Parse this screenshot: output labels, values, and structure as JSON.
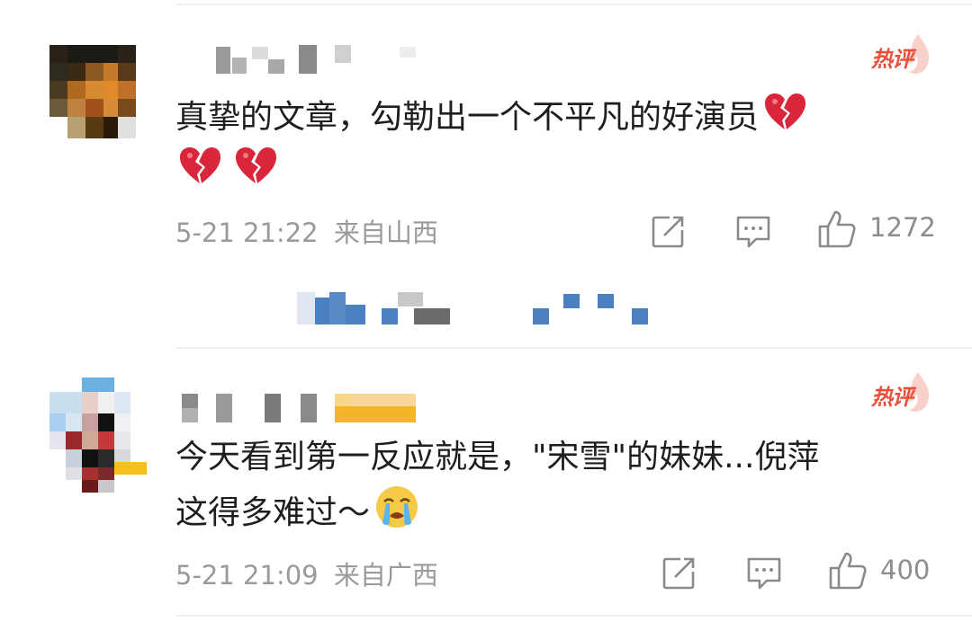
{
  "comments": [
    {
      "hot_badge": "热评",
      "text_line1": "真挚的文章，勾勒出一个不平凡的好演员",
      "emoji_names": [
        "broken-heart-icon",
        "broken-heart-icon",
        "broken-heart-icon"
      ],
      "date": "5-21 21:22",
      "location": "来自山西",
      "like_count": "1272"
    },
    {
      "hot_badge": "热评",
      "text_line1": "今天看到第一反应就是，\"宋雪\"的妹妹...倪萍",
      "text_line2": "这得多难过～",
      "emoji_names": [
        "crying-face-icon"
      ],
      "date": "5-21 21:09",
      "location": "来自广西",
      "like_count": "400"
    }
  ],
  "colors": {
    "hot_badge": "#e8503a",
    "meta_text": "#9a9a9a",
    "icon_stroke": "#8a8a8a",
    "broken_heart": "#d9263a",
    "reply_blue": "#4a7fc0"
  }
}
